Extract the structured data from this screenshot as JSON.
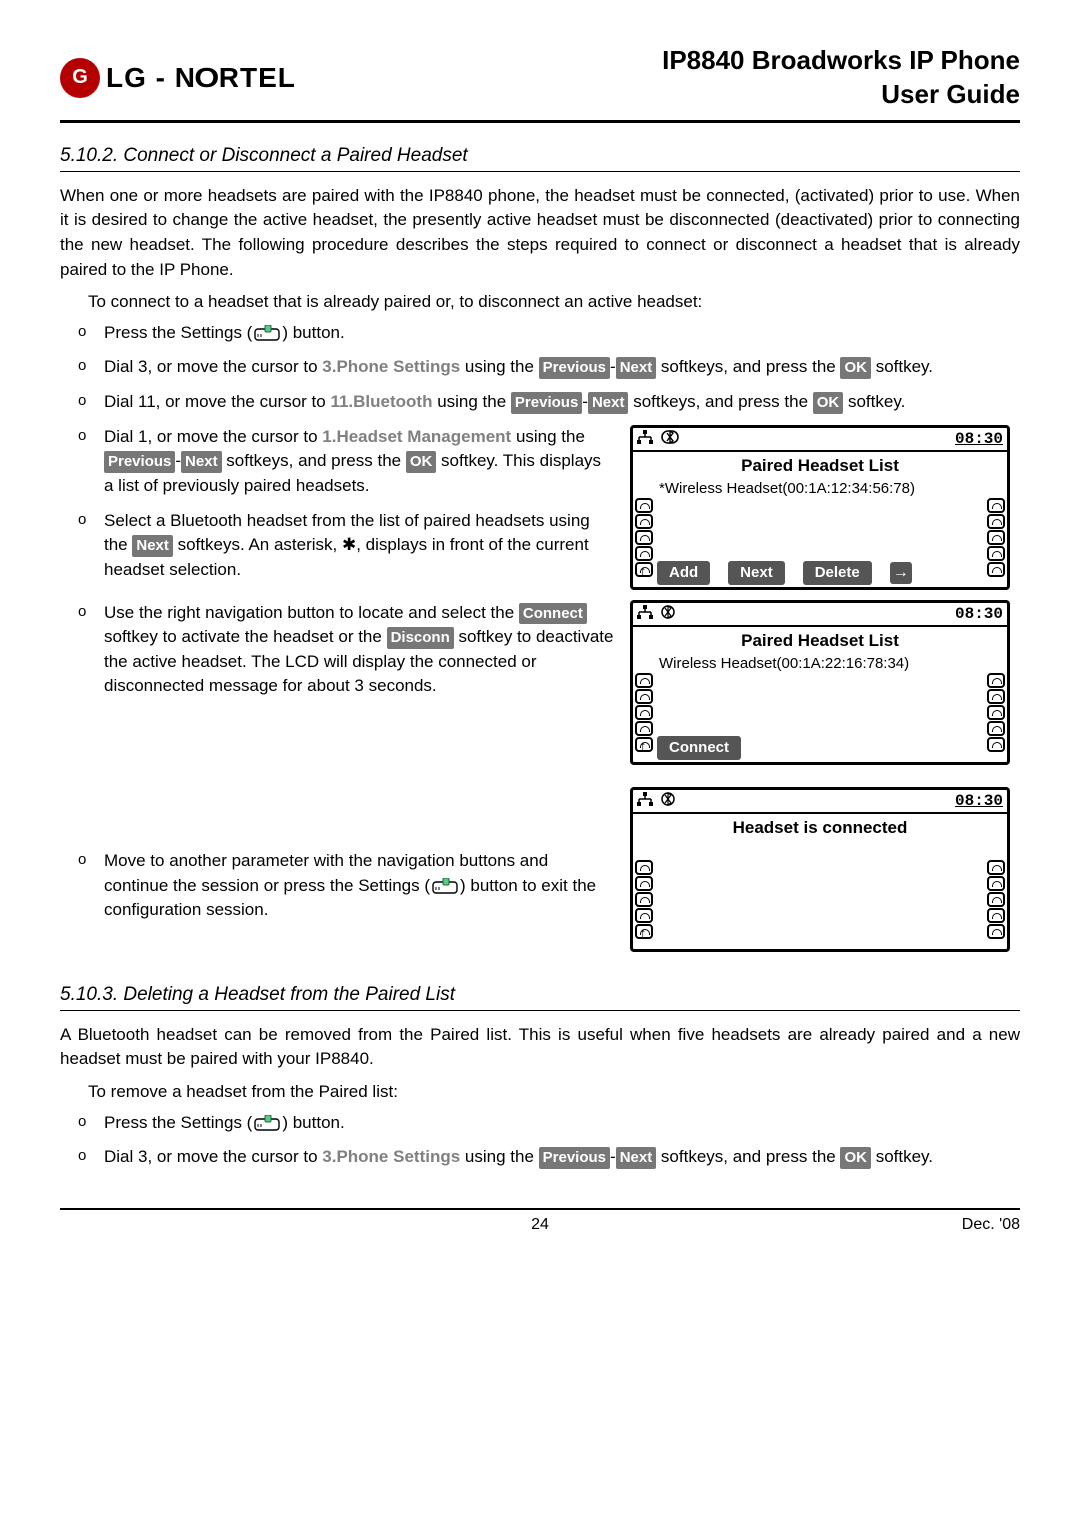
{
  "header": {
    "logo_text": "LG - NORTEL",
    "title_line1": "IP8840 Broadworks IP Phone",
    "title_line2": "User Guide"
  },
  "section_5_10_2": {
    "title": "5.10.2. Connect or Disconnect a Paired Headset",
    "para1": "When one or more headsets are paired with the IP8840 phone, the headset must be connected, (activated) prior to use.  When it is desired to change the active headset, the presently active headset must be disconnected (deactivated) prior to connecting the new headset.  The following procedure describes the steps required to connect or disconnect a headset that is already paired to the IP Phone.",
    "para2": "To connect to a headset that is already paired or, to disconnect an active headset:",
    "bul1_pre": "Press the Settings (",
    "bul1_post": ") button.",
    "bul2_pre": "Dial 3, or move the cursor to ",
    "bul2_head": "3.Phone Settings",
    "bul2_mid": " using the ",
    "bul2_sk_prev": "Previous",
    "bul2_dash": "-",
    "bul2_sk_next": "Next",
    "bul2_mid2": " softkeys, and press the ",
    "bul2_sk_ok": "OK",
    "bul2_post": " softkey.",
    "bul3_pre": "Dial 11, or move the cursor to ",
    "bul3_head": "11.Bluetooth",
    "bul3_mid": " using the ",
    "bul3_sk_prev": "Previous",
    "bul3_dash": "-",
    "bul3_sk_next": "Next",
    "bul3_mid2": " softkeys, and press the ",
    "bul3_sk_ok": "OK",
    "bul3_post": " softkey.",
    "bul4_pre": "Dial 1, or move the cursor to ",
    "bul4_head": "1.Headset Management",
    "bul4_mid": " using the ",
    "bul4_sk_prev": "Previous",
    "bul4_dash": "-",
    "bul4_sk_next": "Next",
    "bul4_mid2": " softkeys, and press the ",
    "bul4_sk_ok": "OK",
    "bul4_post": " softkey.  This displays a list of previously paired headsets.",
    "bul5_pre": "Select a Bluetooth headset from the list of paired headsets using the ",
    "bul5_sk_next": "Next",
    "bul5_mid": " softkeys.  An asterisk, ✱, displays in front of the current headset selection.",
    "bul6_pre": "Use the right navigation button to locate and select the ",
    "bul6_sk_connect": "Connect",
    "bul6_mid": " softkey to activate the headset or the ",
    "bul6_sk_disconn": "Disconn",
    "bul6_post": " softkey to deactivate the active headset.  The LCD will display the connected or disconnected message for about 3 seconds.",
    "bul7_pre": "Move to another parameter with the navigation buttons and continue the session or press the Settings (",
    "bul7_post": ") button to exit the configuration session."
  },
  "section_5_10_3": {
    "title": "5.10.3. Deleting a Headset from the Paired List",
    "para1": "A Bluetooth headset can be removed from the Paired list.  This is useful when five headsets are already paired and a new headset must be paired with your IP8840.",
    "para2": "To remove a headset from the Paired list:",
    "bul1_pre": "Press the Settings (",
    "bul1_post": ") button.",
    "bul2_pre": "Dial 3, or move the cursor to ",
    "bul2_head": "3.Phone Settings",
    "bul2_mid": " using the ",
    "bul2_sk_prev": "Previous",
    "bul2_dash": "-",
    "bul2_sk_next": "Next",
    "bul2_mid2": " softkeys, and press the ",
    "bul2_sk_ok": "OK",
    "bul2_post": " softkey."
  },
  "lcd1": {
    "time": "08:30",
    "title": "Paired Headset List",
    "line1": "*Wireless Headset(00:1A:12:34:56:78)",
    "sk_add": "Add",
    "sk_next": "Next",
    "sk_delete": "Delete"
  },
  "lcd2": {
    "time": "08:30",
    "title": "Paired Headset List",
    "line1": "Wireless Headset(00:1A:22:16:78:34)",
    "sk_connect": "Connect"
  },
  "lcd3": {
    "time": "08:30",
    "title": "Headset is connected"
  },
  "footer": {
    "page": "24",
    "date": "Dec. '08"
  }
}
